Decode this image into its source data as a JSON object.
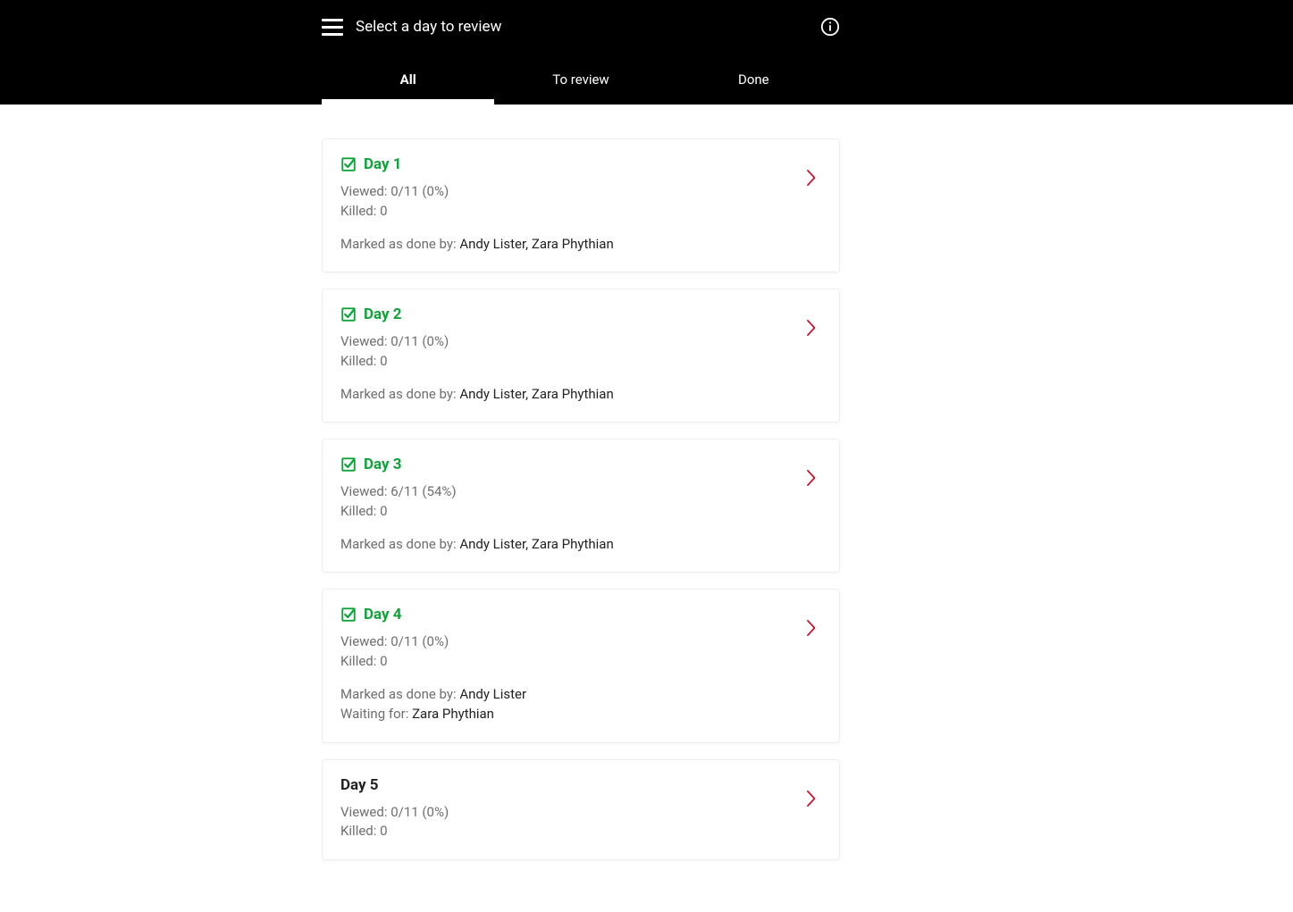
{
  "header": {
    "title": "Select a day to review"
  },
  "tabs": [
    {
      "label": "All",
      "active": true
    },
    {
      "label": "To review",
      "active": false
    },
    {
      "label": "Done",
      "active": false
    }
  ],
  "labels": {
    "viewed_prefix": "Viewed: ",
    "killed_prefix": "Killed: ",
    "marked_prefix": "Marked as done by: ",
    "waiting_prefix": "Waiting for: "
  },
  "colors": {
    "done_green": "#0fa33a",
    "chevron_red": "#c8102e"
  },
  "days": [
    {
      "title": "Day 1",
      "done": true,
      "viewed": "0/11 (0%)",
      "killed": "0",
      "marked_by": "Andy Lister, Zara Phythian",
      "waiting_for": null
    },
    {
      "title": "Day 2",
      "done": true,
      "viewed": "0/11 (0%)",
      "killed": "0",
      "marked_by": "Andy Lister, Zara Phythian",
      "waiting_for": null
    },
    {
      "title": "Day 3",
      "done": true,
      "viewed": "6/11 (54%)",
      "killed": "0",
      "marked_by": "Andy Lister, Zara Phythian",
      "waiting_for": null
    },
    {
      "title": "Day 4",
      "done": true,
      "viewed": "0/11 (0%)",
      "killed": "0",
      "marked_by": "Andy Lister",
      "waiting_for": "Zara Phythian"
    },
    {
      "title": "Day 5",
      "done": false,
      "viewed": "0/11 (0%)",
      "killed": "0",
      "marked_by": null,
      "waiting_for": null
    }
  ]
}
